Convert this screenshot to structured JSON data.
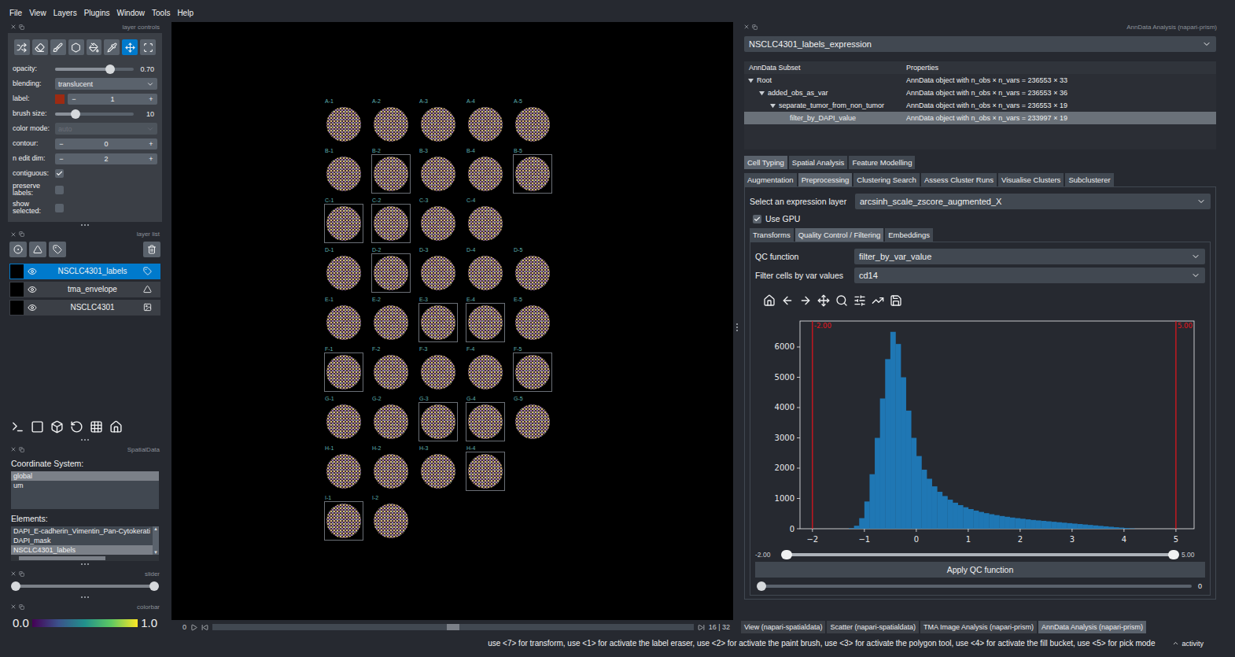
{
  "menu": [
    "File",
    "View",
    "Layers",
    "Plugins",
    "Window",
    "Tools",
    "Help"
  ],
  "layer_controls": {
    "title": "layer controls",
    "tools": [
      {
        "selected": false
      },
      {
        "selected": false
      },
      {
        "selected": false
      },
      {
        "selected": false
      },
      {
        "selected": false
      },
      {
        "selected": false
      },
      {
        "selected": true
      },
      {
        "selected": false
      }
    ],
    "rows": [
      {
        "kind": "slider",
        "label": "opacity:",
        "level": 0.7,
        "reading": "0.70"
      },
      {
        "kind": "dropdown",
        "label": "blending:",
        "value": "translucent",
        "disabled": false
      },
      {
        "kind": "label-spin",
        "label": "label:",
        "color": "#9c2a12",
        "minus": "−",
        "value": "1",
        "plus": "+"
      },
      {
        "kind": "slider",
        "label": "brush size:",
        "level": 0.26,
        "reading": "10"
      },
      {
        "kind": "dropdown",
        "label": "color mode:",
        "value": "auto",
        "disabled": true
      },
      {
        "kind": "spin",
        "label": "contour:",
        "minus": "−",
        "value": "0",
        "plus": "+"
      },
      {
        "kind": "spin",
        "label": "n edit dim:",
        "minus": "−",
        "value": "2",
        "plus": "+"
      },
      {
        "kind": "checkbox",
        "label": "contiguous:",
        "checked": true
      },
      {
        "kind": "checkbox",
        "label": "preserve labels:",
        "checked": false
      },
      {
        "kind": "checkbox",
        "label": "show selected:",
        "checked": false
      }
    ]
  },
  "layer_list": {
    "title": "layer list",
    "layers": [
      {
        "name": "NSCLC4301_labels",
        "visible": true,
        "selected": true,
        "kind": "labels"
      },
      {
        "name": "tma_envelope",
        "visible": true,
        "selected": false,
        "kind": "shapes"
      },
      {
        "name": "NSCLC4301",
        "visible": true,
        "selected": false,
        "kind": "image"
      }
    ]
  },
  "spatialdata": {
    "title": "SpatialData",
    "coord_label": "Coordinate System:",
    "coords": [
      {
        "name": "global",
        "selected": true
      },
      {
        "name": "um",
        "selected": false
      }
    ],
    "elements_label": "Elements:",
    "elements": [
      {
        "name": "DAPI_E-cadherin_Vimentin_Pan-Cytokerati",
        "selected": false
      },
      {
        "name": "DAPI_mask",
        "selected": false
      },
      {
        "name": "NSCLC4301_labels",
        "selected": true
      }
    ]
  },
  "slider_dock": {
    "title": "slider",
    "low": 0,
    "high": 1
  },
  "colorbar": {
    "title": "colorbar",
    "min": "0.0",
    "max": "1.0"
  },
  "canvas": {
    "rows": [
      [
        {
          "label": "A-1",
          "enveloped": false
        },
        {
          "label": "A-2",
          "enveloped": false
        },
        {
          "label": "A-3",
          "enveloped": false
        },
        {
          "label": "A-4",
          "enveloped": false
        },
        {
          "label": "A-5",
          "enveloped": false
        }
      ],
      [
        {
          "label": "B-1",
          "enveloped": false
        },
        {
          "label": "B-2",
          "enveloped": true
        },
        {
          "label": "B-3",
          "enveloped": false
        },
        {
          "label": "B-4",
          "enveloped": false
        },
        {
          "label": "B-5",
          "enveloped": true
        }
      ],
      [
        {
          "label": "C-1",
          "enveloped": true
        },
        {
          "label": "C-2",
          "enveloped": true
        },
        {
          "label": "C-3",
          "enveloped": false
        },
        {
          "label": "C-4",
          "enveloped": false
        }
      ],
      [
        {
          "label": "D-1",
          "enveloped": false
        },
        {
          "label": "D-2",
          "enveloped": true
        },
        {
          "label": "D-3",
          "enveloped": false
        },
        {
          "label": "D-4",
          "enveloped": false
        },
        {
          "label": "D-5",
          "enveloped": false
        }
      ],
      [
        {
          "label": "E-1",
          "enveloped": false
        },
        {
          "label": "E-2",
          "enveloped": false
        },
        {
          "label": "E-3",
          "enveloped": true
        },
        {
          "label": "E-4",
          "enveloped": true
        },
        {
          "label": "E-5",
          "enveloped": false
        }
      ],
      [
        {
          "label": "F-1",
          "enveloped": true
        },
        {
          "label": "F-2",
          "enveloped": false
        },
        {
          "label": "F-3",
          "enveloped": false
        },
        {
          "label": "F-4",
          "enveloped": false
        },
        {
          "label": "F-5",
          "enveloped": true
        }
      ],
      [
        {
          "label": "G-1",
          "enveloped": false
        },
        {
          "label": "G-2",
          "enveloped": false
        },
        {
          "label": "G-3",
          "enveloped": true
        },
        {
          "label": "G-4",
          "enveloped": true
        },
        {
          "label": "G-5",
          "enveloped": false
        }
      ],
      [
        {
          "label": "H-1",
          "enveloped": false
        },
        {
          "label": "H-2",
          "enveloped": false
        },
        {
          "label": "H-3",
          "enveloped": false
        },
        {
          "label": "H-4",
          "enveloped": true
        }
      ],
      [
        {
          "label": "I-1",
          "enveloped": true
        },
        {
          "label": "I-2",
          "enveloped": false
        }
      ]
    ],
    "dims": {
      "start": "0",
      "position": "16 | 32",
      "level": 0.5
    }
  },
  "dock": {
    "title": "AnnData Analysis (napari-prism)",
    "dataset": "NSCLC4301_labels_expression",
    "tree": {
      "columns": [
        "AnnData Subset",
        "Properties"
      ],
      "rows": [
        {
          "name": "Root",
          "properties": "AnnData object with n_obs × n_vars = 236553 × 33",
          "depth": 0,
          "expandable": true,
          "expanded": true,
          "selected": false
        },
        {
          "name": "added_obs_as_var",
          "properties": "AnnData object with n_obs × n_vars = 236553 × 36",
          "depth": 1,
          "expandable": true,
          "expanded": true,
          "selected": false
        },
        {
          "name": "separate_tumor_from_non_tumor",
          "properties": "AnnData object with n_obs × n_vars = 236553 × 19",
          "depth": 2,
          "expandable": true,
          "expanded": true,
          "selected": false
        },
        {
          "name": "filter_by_DAPI_value",
          "properties": "AnnData object with n_obs × n_vars = 233997 × 19",
          "depth": 3,
          "expandable": false,
          "expanded": false,
          "selected": true
        }
      ]
    },
    "tabs": [
      {
        "label": "Cell Typing",
        "selected": true
      },
      {
        "label": "Spatial Analysis",
        "selected": false
      },
      {
        "label": "Feature Modelling",
        "selected": false
      }
    ],
    "subtabs": [
      {
        "label": "Augmentation",
        "selected": false
      },
      {
        "label": "Preprocessing",
        "selected": true
      },
      {
        "label": "Clustering Search",
        "selected": false
      },
      {
        "label": "Assess Cluster Runs",
        "selected": false
      },
      {
        "label": "Visualise Clusters",
        "selected": false
      },
      {
        "label": "Subclusterer",
        "selected": false
      }
    ],
    "expression": {
      "label": "Select an expression layer",
      "value": "arcsinh_scale_zscore_augmented_X"
    },
    "gpu": {
      "label": "Use GPU",
      "checked": true
    },
    "inner_tabs": [
      {
        "label": "Transforms",
        "selected": false
      },
      {
        "label": "Quality Control / Filtering",
        "selected": true
      },
      {
        "label": "Embeddings",
        "selected": false
      }
    ],
    "qc_function": {
      "label": "QC function",
      "value": "filter_by_var_value"
    },
    "var_filter": {
      "label": "Filter cells by var values",
      "value": "cd14"
    },
    "chart": {
      "x_range": [
        -2.24,
        5.35
      ],
      "y_range": [
        0,
        6857
      ],
      "x_ticks": [
        {
          "label": "−2",
          "value": -2
        },
        {
          "label": "−1",
          "value": -1
        },
        {
          "label": "0",
          "value": 0
        },
        {
          "label": "1",
          "value": 1
        },
        {
          "label": "2",
          "value": 2
        },
        {
          "label": "3",
          "value": 3
        },
        {
          "label": "4",
          "value": 4
        },
        {
          "label": "5",
          "value": 5
        }
      ],
      "y_ticks": [
        {
          "label": "0",
          "value": 0
        },
        {
          "label": "1000",
          "value": 1000
        },
        {
          "label": "2000",
          "value": 2000
        },
        {
          "label": "3000",
          "value": 3000
        },
        {
          "label": "4000",
          "value": 4000
        },
        {
          "label": "5000",
          "value": 5000
        },
        {
          "label": "6000",
          "value": 6000
        }
      ],
      "series": [
        {
          "bin_start": -1.3,
          "bin_width": 0.1,
          "counts": [
            20,
            100,
            350,
            900,
            1800,
            3000,
            4300,
            5600,
            6500,
            6100,
            5000,
            3900,
            3000,
            2400,
            1950,
            1650,
            1400,
            1220,
            1080,
            960,
            860,
            780,
            710,
            650,
            600,
            555,
            515,
            480,
            450,
            420,
            395,
            370,
            350,
            330,
            310,
            290,
            275,
            260,
            245,
            230,
            215,
            200,
            185,
            170,
            155,
            140,
            125,
            110,
            95,
            80,
            65,
            50,
            38,
            25,
            12
          ]
        }
      ],
      "thresholds": [
        {
          "label": "-2.00",
          "value": -2
        },
        {
          "label": "5.00",
          "value": 5
        }
      ]
    },
    "range": {
      "low_label": "-2.00",
      "high_label": "5.00",
      "low": 0,
      "high": 1
    },
    "apply": "Apply QC function",
    "slider": {
      "level": 0,
      "reading": "0"
    }
  },
  "dock_tabs": [
    {
      "label": "View (napari-spatialdata)",
      "selected": false
    },
    {
      "label": "Scatter (napari-spatialdata)",
      "selected": false
    },
    {
      "label": "TMA Image Analysis (napari-prism)",
      "selected": false
    },
    {
      "label": "AnnData Analysis (napari-prism)",
      "selected": true
    }
  ],
  "status": {
    "text": "use <7> for transform, use <1> for activate the label eraser, use <2> for activate the paint brush, use <3> for activate the polygon tool, use <4> for activate the fill bucket, use <5> for pick mode",
    "activity": "activity"
  }
}
